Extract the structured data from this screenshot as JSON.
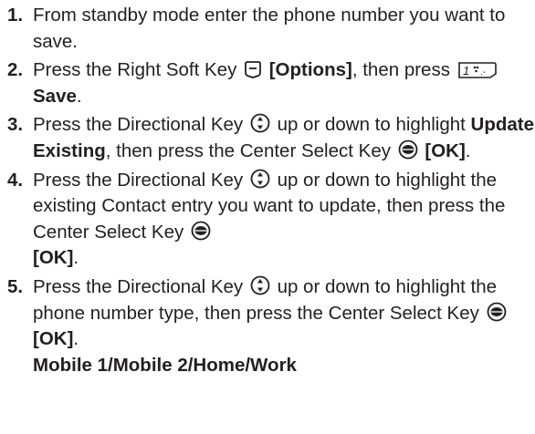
{
  "steps": [
    {
      "number": "1.",
      "text": "From standby mode enter the phone number you want to save."
    },
    {
      "number": "2.",
      "pre": "Press the Right Soft Key ",
      "icon": "right-soft-key-icon",
      "bold1": "[Options]",
      "mid": ", then press ",
      "icon2": "key-1-save-icon",
      "bold2": "Save",
      "end": "."
    },
    {
      "number": "3.",
      "pre": "Press the Directional Key ",
      "icon": "directional-key-icon",
      "mid": " up or down to highlight ",
      "bold1": "Update Existing",
      "mid2": ", then press the Center Select Key ",
      "icon2": "center-select-key-icon",
      "bold2": "[OK]",
      "end": "."
    },
    {
      "number": "4.",
      "pre": "Press the Directional Key ",
      "icon": "directional-key-icon",
      "mid": " up or down to highlight the existing Contact entry you want to update, then press the Center Select Key ",
      "icon2": "center-select-key-icon",
      "bold2": "[OK]",
      "end": "."
    },
    {
      "number": "5.",
      "pre": "Press the Directional Key ",
      "icon": "directional-key-icon",
      "mid": " up or down to highlight the phone number type, then press the Center Select Key ",
      "icon2": "center-select-key-icon",
      "bold2": "[OK]",
      "end": ".",
      "sub": "Mobile 1/Mobile 2/Home/Work"
    }
  ],
  "colors": {
    "text": "#231f20",
    "background": "#ffffff"
  }
}
